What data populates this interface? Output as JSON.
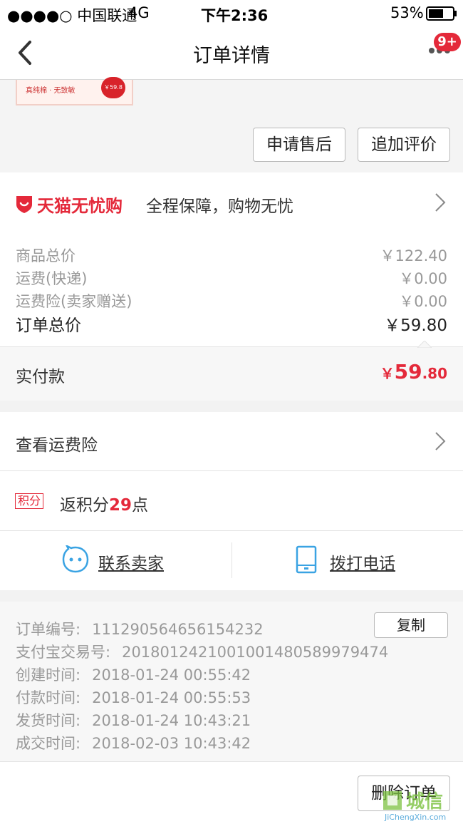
{
  "status_bar": {
    "carrier": "●●●●○ 中国联通",
    "network": "4G",
    "time": "下午2:36",
    "battery": "53%"
  },
  "nav": {
    "title": "订单详情",
    "badge": "9+"
  },
  "product_thumb": {
    "caption": "真纯棉 · 无致敏",
    "price_tag": "￥59.8"
  },
  "actions": {
    "after_sale": "申请售后",
    "add_review": "追加评价"
  },
  "guarantee": {
    "brand": "天猫无忧购",
    "text": "全程保障，购物无忧"
  },
  "price_rows": [
    {
      "label": "商品总价",
      "value": "￥122.40"
    },
    {
      "label": "运费(快递)",
      "value": "￥0.00"
    },
    {
      "label": "运费险(卖家赠送)",
      "value": "￥0.00"
    }
  ],
  "order_total": {
    "label": "订单总价",
    "value": "￥59.80"
  },
  "paid": {
    "label": "实付款",
    "currency": "￥",
    "int": "59",
    "dec": ".80"
  },
  "freight_insurance": "查看运费险",
  "points": {
    "tag": "积分",
    "prefix": "返积分",
    "count": "29",
    "suffix": "点"
  },
  "contact": {
    "seller": "联系卖家",
    "phone": "拨打电话"
  },
  "order_info": [
    {
      "label": "订单编号:",
      "value": "111290564656154232"
    },
    {
      "label": "支付宝交易号:",
      "value": "2018012421001001480589979474"
    },
    {
      "label": "创建时间:",
      "value": "2018-01-24 00:55:42"
    },
    {
      "label": "付款时间:",
      "value": "2018-01-24 00:55:53"
    },
    {
      "label": "发货时间:",
      "value": "2018-01-24 10:43:21"
    },
    {
      "label": "成交时间:",
      "value": "2018-02-03 10:43:42"
    }
  ],
  "copy_label": "复制",
  "delete_label": "删除订单",
  "watermark": {
    "brand": "城信",
    "url": "JiChengXin.com"
  },
  "colors": {
    "accent": "#e4293a",
    "muted": "#999999",
    "link_blue": "#3aa3e3"
  }
}
